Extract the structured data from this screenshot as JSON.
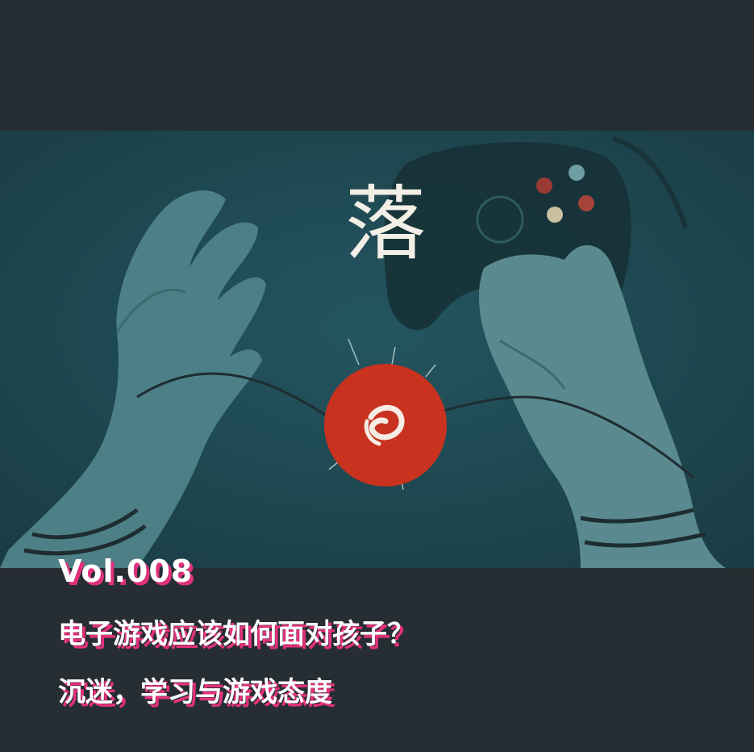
{
  "cover": {
    "title_glyph": "落",
    "colors": {
      "background": "#262e33",
      "art_teal": "#1f4a52",
      "badge_red": "#c8321f",
      "caption_shadow": "#e0317a"
    },
    "badge_icon": "luo-logo-icon",
    "volume": "Vol.008",
    "headline": "电子游戏应该如何面对孩子？",
    "subheadline": "沉迷，学习与游戏态度"
  }
}
